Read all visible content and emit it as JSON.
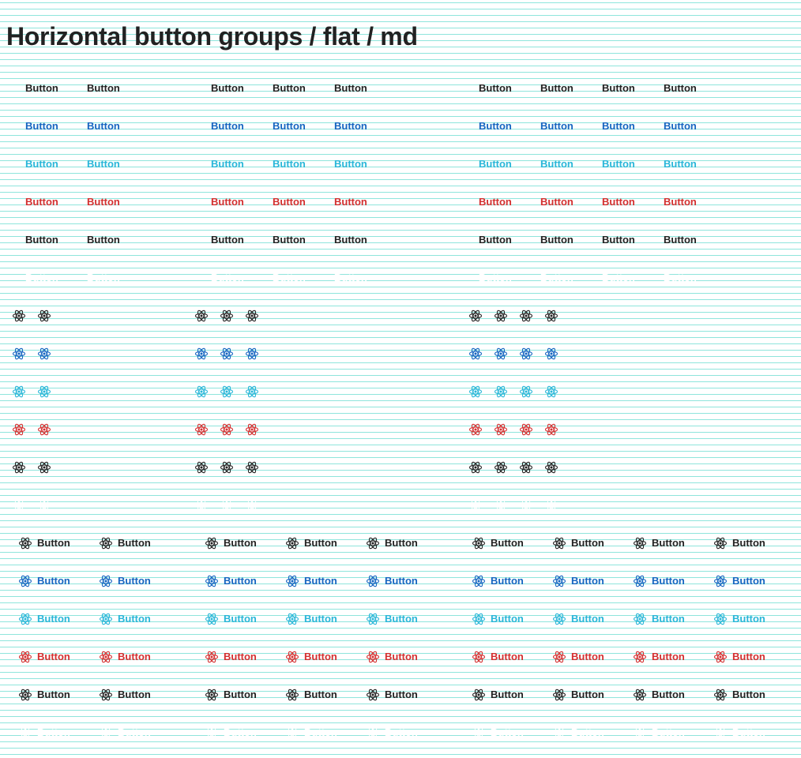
{
  "page": {
    "title": "Horizontal button groups / flat / md"
  },
  "button": {
    "label": "Button",
    "icon": "react-atom-icon"
  },
  "variants": [
    {
      "name": "default",
      "color": "#222222",
      "disabled": false
    },
    {
      "name": "primary",
      "color": "#1565c0",
      "disabled": false
    },
    {
      "name": "info",
      "color": "#29b6d8",
      "disabled": false
    },
    {
      "name": "danger",
      "color": "#d32f2f",
      "disabled": false
    },
    {
      "name": "dark",
      "color": "#222222",
      "disabled": false
    },
    {
      "name": "light",
      "color": "#ffffff",
      "disabled": false
    }
  ],
  "sections": [
    {
      "kind": "text-only"
    },
    {
      "kind": "icon-only"
    },
    {
      "kind": "icon-and-text"
    }
  ],
  "groups": [
    {
      "button_count": 2
    },
    {
      "button_count": 3
    },
    {
      "button_count": 4
    }
  ]
}
